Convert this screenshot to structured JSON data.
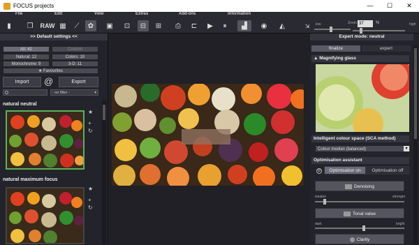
{
  "window": {
    "title": "FOCUS projects",
    "minimize": "—",
    "maximize": "☐",
    "close": "✕"
  },
  "menu": [
    "File",
    "Edit",
    "View",
    "Extras",
    "Add-ons",
    "Information"
  ],
  "toolbar": {
    "raw_label": "RAW",
    "low_label": "low",
    "high_label": "high",
    "zoom_label": "Zoom",
    "zoom_value": "37",
    "zoom_unit": "%"
  },
  "left": {
    "header": ">> Default settings <<",
    "filters": {
      "all": "All: 42",
      "custom": "Custom",
      "natural": "Natural: 12",
      "colors": "Colors: 10",
      "monochrome": "Monochrome: 9",
      "three_d": "3-D: 11",
      "favourites": "Favourites"
    },
    "import": "Import",
    "export": "Export",
    "at": "@",
    "filter_placeholder": "- no filter -",
    "preset1": "natural neutral",
    "preset2": "natural maximum focus"
  },
  "right": {
    "header": "Expert mode: neutral",
    "tab_finalize": "finalize",
    "tab_expert": "expert",
    "magnifier": "Magnifying glass",
    "colour_space": "Intelligent colour space (SCA method)",
    "colour_median": "Colour median (balanced)",
    "optimisation": "Optimisation assistant",
    "opt_on": "Optimisation on",
    "opt_off": "Optimisation off",
    "denoising": "Denoising",
    "weaker": "weaker",
    "stronger": "stronger",
    "tonal": "Tonal value",
    "dark": "dark",
    "bright": "bright",
    "clarity": "Clarity"
  }
}
